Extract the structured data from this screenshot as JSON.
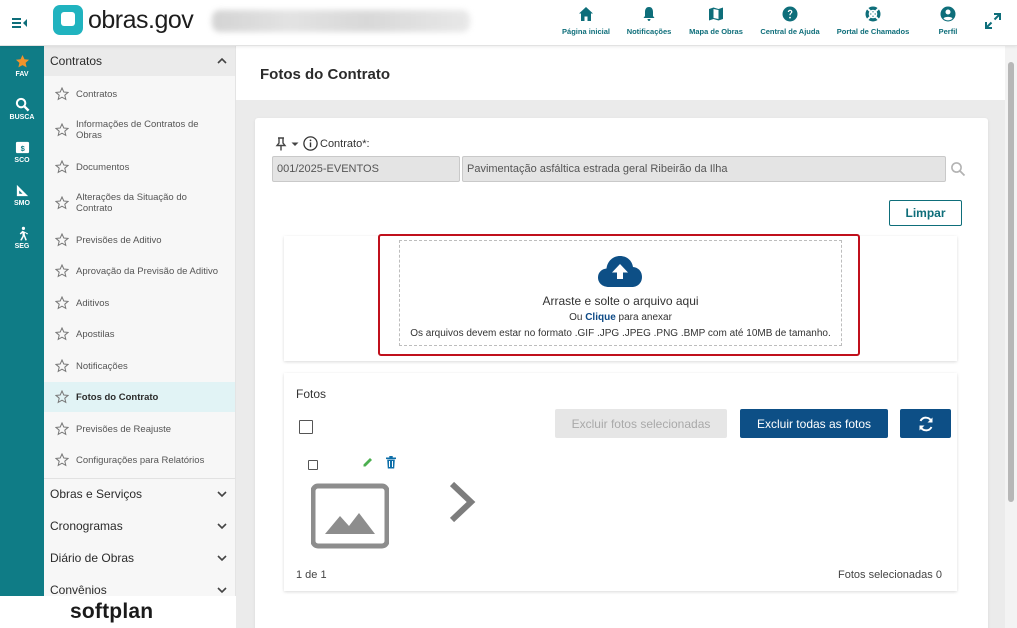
{
  "app": {
    "logo_text": "obras.gov",
    "brand_footer": "softplan"
  },
  "topnav": [
    {
      "label": "Página inicial",
      "icon": "home-icon"
    },
    {
      "label": "Notificações",
      "icon": "bell-icon"
    },
    {
      "label": "Mapa de Obras",
      "icon": "map-icon"
    },
    {
      "label": "Central de Ajuda",
      "icon": "help-icon"
    },
    {
      "label": "Portal de Chamados",
      "icon": "lifebuoy-icon"
    },
    {
      "label": "Perfil",
      "icon": "user-icon"
    }
  ],
  "rail": [
    {
      "label": "FAV",
      "icon": "star-icon"
    },
    {
      "label": "BUSCA",
      "icon": "search-icon"
    },
    {
      "label": "SCO",
      "icon": "dollar-card-icon"
    },
    {
      "label": "SMO",
      "icon": "set-square-icon"
    },
    {
      "label": "SEG",
      "icon": "walker-icon"
    }
  ],
  "sidebar": {
    "open_section": "Contratos",
    "items": [
      {
        "label": "Contratos"
      },
      {
        "label": "Informações de Contratos de Obras"
      },
      {
        "label": "Documentos"
      },
      {
        "label": "Alterações da Situação do Contrato"
      },
      {
        "label": "Previsões de Aditivo"
      },
      {
        "label": "Aprovação da Previsão de Aditivo"
      },
      {
        "label": "Aditivos"
      },
      {
        "label": "Apostilas"
      },
      {
        "label": "Notificações"
      },
      {
        "label": "Fotos do Contrato",
        "active": true
      },
      {
        "label": "Previsões de Reajuste"
      },
      {
        "label": "Configurações para Relatórios"
      }
    ],
    "collapsed_sections": [
      {
        "label": "Obras e Serviços"
      },
      {
        "label": "Cronogramas"
      },
      {
        "label": "Diário de Obras"
      },
      {
        "label": "Convênios"
      }
    ]
  },
  "page": {
    "title": "Fotos do Contrato"
  },
  "contract_field": {
    "label": "Contrato*:",
    "code": "001/2025-EVENTOS",
    "description": "Pavimentação asfáltica estrada geral Ribeirão da Ilha"
  },
  "actions": {
    "clear_label": "Limpar"
  },
  "upload": {
    "main_text": "Arraste e solte o arquivo aqui",
    "sub_prefix": "Ou",
    "sub_link": "Clique",
    "sub_suffix": "para anexar",
    "formats_note": "Os arquivos devem estar no formato .GIF .JPG .JPEG .PNG .BMP com até 10MB de tamanho."
  },
  "photos": {
    "title": "Fotos",
    "delete_selected_label": "Excluir fotos selecionadas",
    "delete_all_label": "Excluir todas as fotos",
    "pagination": "1 de 1",
    "selected_count": "Fotos selecionadas 0"
  },
  "colors": {
    "brand_teal": "#0f7c86",
    "primary_blue": "#0d4f86",
    "highlight_red": "#c0101c"
  }
}
